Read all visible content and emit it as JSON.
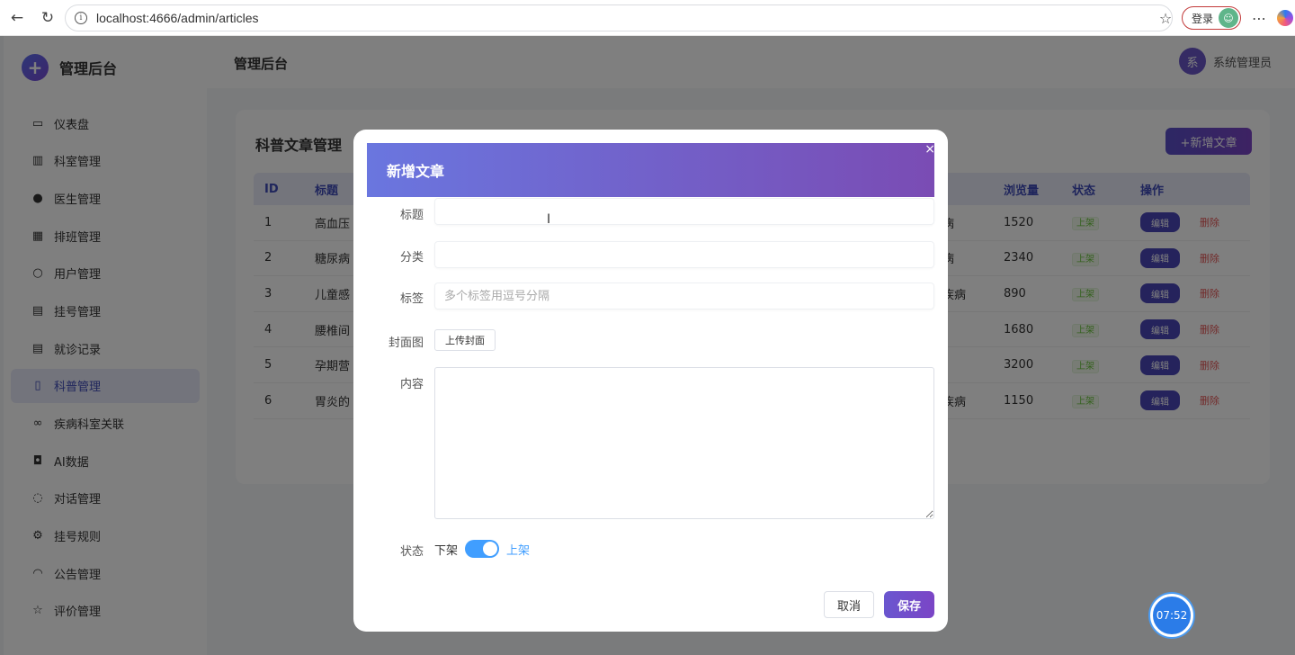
{
  "browser": {
    "url": "localhost:4666/admin/articles",
    "login_label": "登录"
  },
  "sidebar": {
    "brand": "管理后台",
    "items": [
      {
        "label": "仪表盘",
        "icon": "monitor-icon"
      },
      {
        "label": "科室管理",
        "icon": "building-icon"
      },
      {
        "label": "医生管理",
        "icon": "doctor-icon"
      },
      {
        "label": "排班管理",
        "icon": "calendar-icon"
      },
      {
        "label": "用户管理",
        "icon": "user-icon"
      },
      {
        "label": "挂号管理",
        "icon": "document-icon"
      },
      {
        "label": "就诊记录",
        "icon": "record-icon"
      },
      {
        "label": "科普管理",
        "icon": "book-icon"
      },
      {
        "label": "疾病科室关联",
        "icon": "link-icon"
      },
      {
        "label": "AI数据",
        "icon": "chip-icon"
      },
      {
        "label": "对话管理",
        "icon": "chat-icon"
      },
      {
        "label": "挂号规则",
        "icon": "gear-icon"
      },
      {
        "label": "公告管理",
        "icon": "bell-icon"
      },
      {
        "label": "评价管理",
        "icon": "star-icon"
      }
    ],
    "active_index": 7
  },
  "header": {
    "title": "管理后台",
    "avatar_text": "系",
    "user_name": "系统管理员"
  },
  "card": {
    "title": "科普文章管理",
    "add_button": "+新增文章"
  },
  "table": {
    "columns": [
      "ID",
      "标题",
      "浏览量",
      "状态",
      "操作"
    ],
    "rows": [
      {
        "id": "1",
        "title": "高血压",
        "disease": "病",
        "views": "1520",
        "status": "上架"
      },
      {
        "id": "2",
        "title": "糖尿病",
        "disease": "病",
        "views": "2340",
        "status": "上架"
      },
      {
        "id": "3",
        "title": "儿童感",
        "disease": "疾病",
        "views": "890",
        "status": "上架"
      },
      {
        "id": "4",
        "title": "腰椎间",
        "disease": "",
        "views": "1680",
        "status": "上架"
      },
      {
        "id": "5",
        "title": "孕期营",
        "disease": "",
        "views": "3200",
        "status": "上架"
      },
      {
        "id": "6",
        "title": "胃炎的",
        "disease": "疾病",
        "views": "1150",
        "status": "上架"
      }
    ],
    "edit_label": "编辑",
    "delete_label": "删除"
  },
  "modal": {
    "title": "新增文章",
    "close_glyph": "×",
    "fields": {
      "title_label": "标题",
      "title_value": "",
      "category_label": "分类",
      "category_value": "",
      "tags_label": "标签",
      "tags_placeholder": "多个标签用逗号分隔",
      "cover_label": "封面图",
      "upload_label": "上传封面",
      "content_label": "内容",
      "status_label": "状态",
      "status_off": "下架",
      "status_on": "上架",
      "status_checked": true
    },
    "cancel_label": "取消",
    "save_label": "保存"
  },
  "timer": "07:52"
}
